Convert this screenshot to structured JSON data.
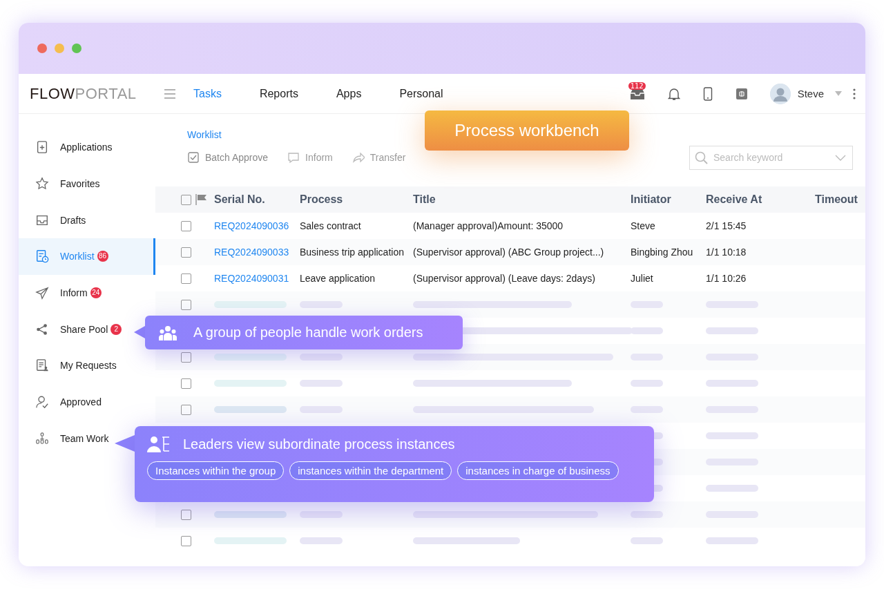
{
  "logo": {
    "part_1": "FLOW",
    "part_2": "PORTAL"
  },
  "nav_tabs": [
    {
      "label": "Tasks",
      "selected": true
    },
    {
      "label": "Reports",
      "selected": false
    },
    {
      "label": "Apps",
      "selected": false
    },
    {
      "label": "Personal",
      "selected": false
    }
  ],
  "header": {
    "inbox_badge": "112",
    "user_name": "Steve"
  },
  "sidebar": {
    "items": [
      {
        "label": "Applications",
        "selected": false
      },
      {
        "label": "Favorites",
        "selected": false
      },
      {
        "label": "Drafts",
        "selected": false
      },
      {
        "label": "Worklist",
        "selected": true,
        "badge": "86"
      },
      {
        "label": "Inform",
        "selected": false,
        "badge": "24"
      },
      {
        "label": "Share Pool",
        "selected": false,
        "badge": "2"
      },
      {
        "label": "My Requests",
        "selected": false
      },
      {
        "label": "Approved",
        "selected": false
      },
      {
        "label": "Team Work",
        "selected": false
      }
    ]
  },
  "breadcrumb": "Worklist",
  "toolbar": [
    "Batch Approve",
    "Inform",
    "Transfer"
  ],
  "search": {
    "placeholder": "Search keyword"
  },
  "table": {
    "select_all_checked": false,
    "columns": [
      "Serial No.",
      "Process",
      "Title",
      "Initiator",
      "Receive At",
      "Timeout"
    ],
    "rows": [
      {
        "checked": false,
        "serial": "REQ2024090036",
        "process": "Sales contract",
        "title": "(Manager approval)Amount:  35000",
        "initiator": "Steve",
        "receive_at": "2/1 15:45"
      },
      {
        "checked": false,
        "serial": "REQ2024090033",
        "process": "Business trip application",
        "title": "(Supervisor approval) (ABC Group project...)",
        "initiator": "Bingbing Zhou",
        "receive_at": "1/1 10:18"
      },
      {
        "checked": false,
        "serial": "REQ2024090031",
        "process": "Leave application",
        "title": "(Supervisor approval) (Leave days: 2days)",
        "initiator": "Juliet",
        "receive_at": "1/1 10:26"
      }
    ],
    "skeleton_row_checkboxes": [
      {
        "checked": false
      },
      {
        "checked": false
      },
      {
        "checked": false
      },
      {
        "checked": false
      },
      {
        "checked": false
      },
      {
        "checked": false
      }
    ]
  },
  "callouts": {
    "workbench": "Process workbench",
    "group": "A group of people handle work orders",
    "leaders": {
      "text": "Leaders view subordinate process instances",
      "tags": [
        "Instances within the group",
        "instances within the department",
        "instances in charge of business"
      ]
    }
  }
}
